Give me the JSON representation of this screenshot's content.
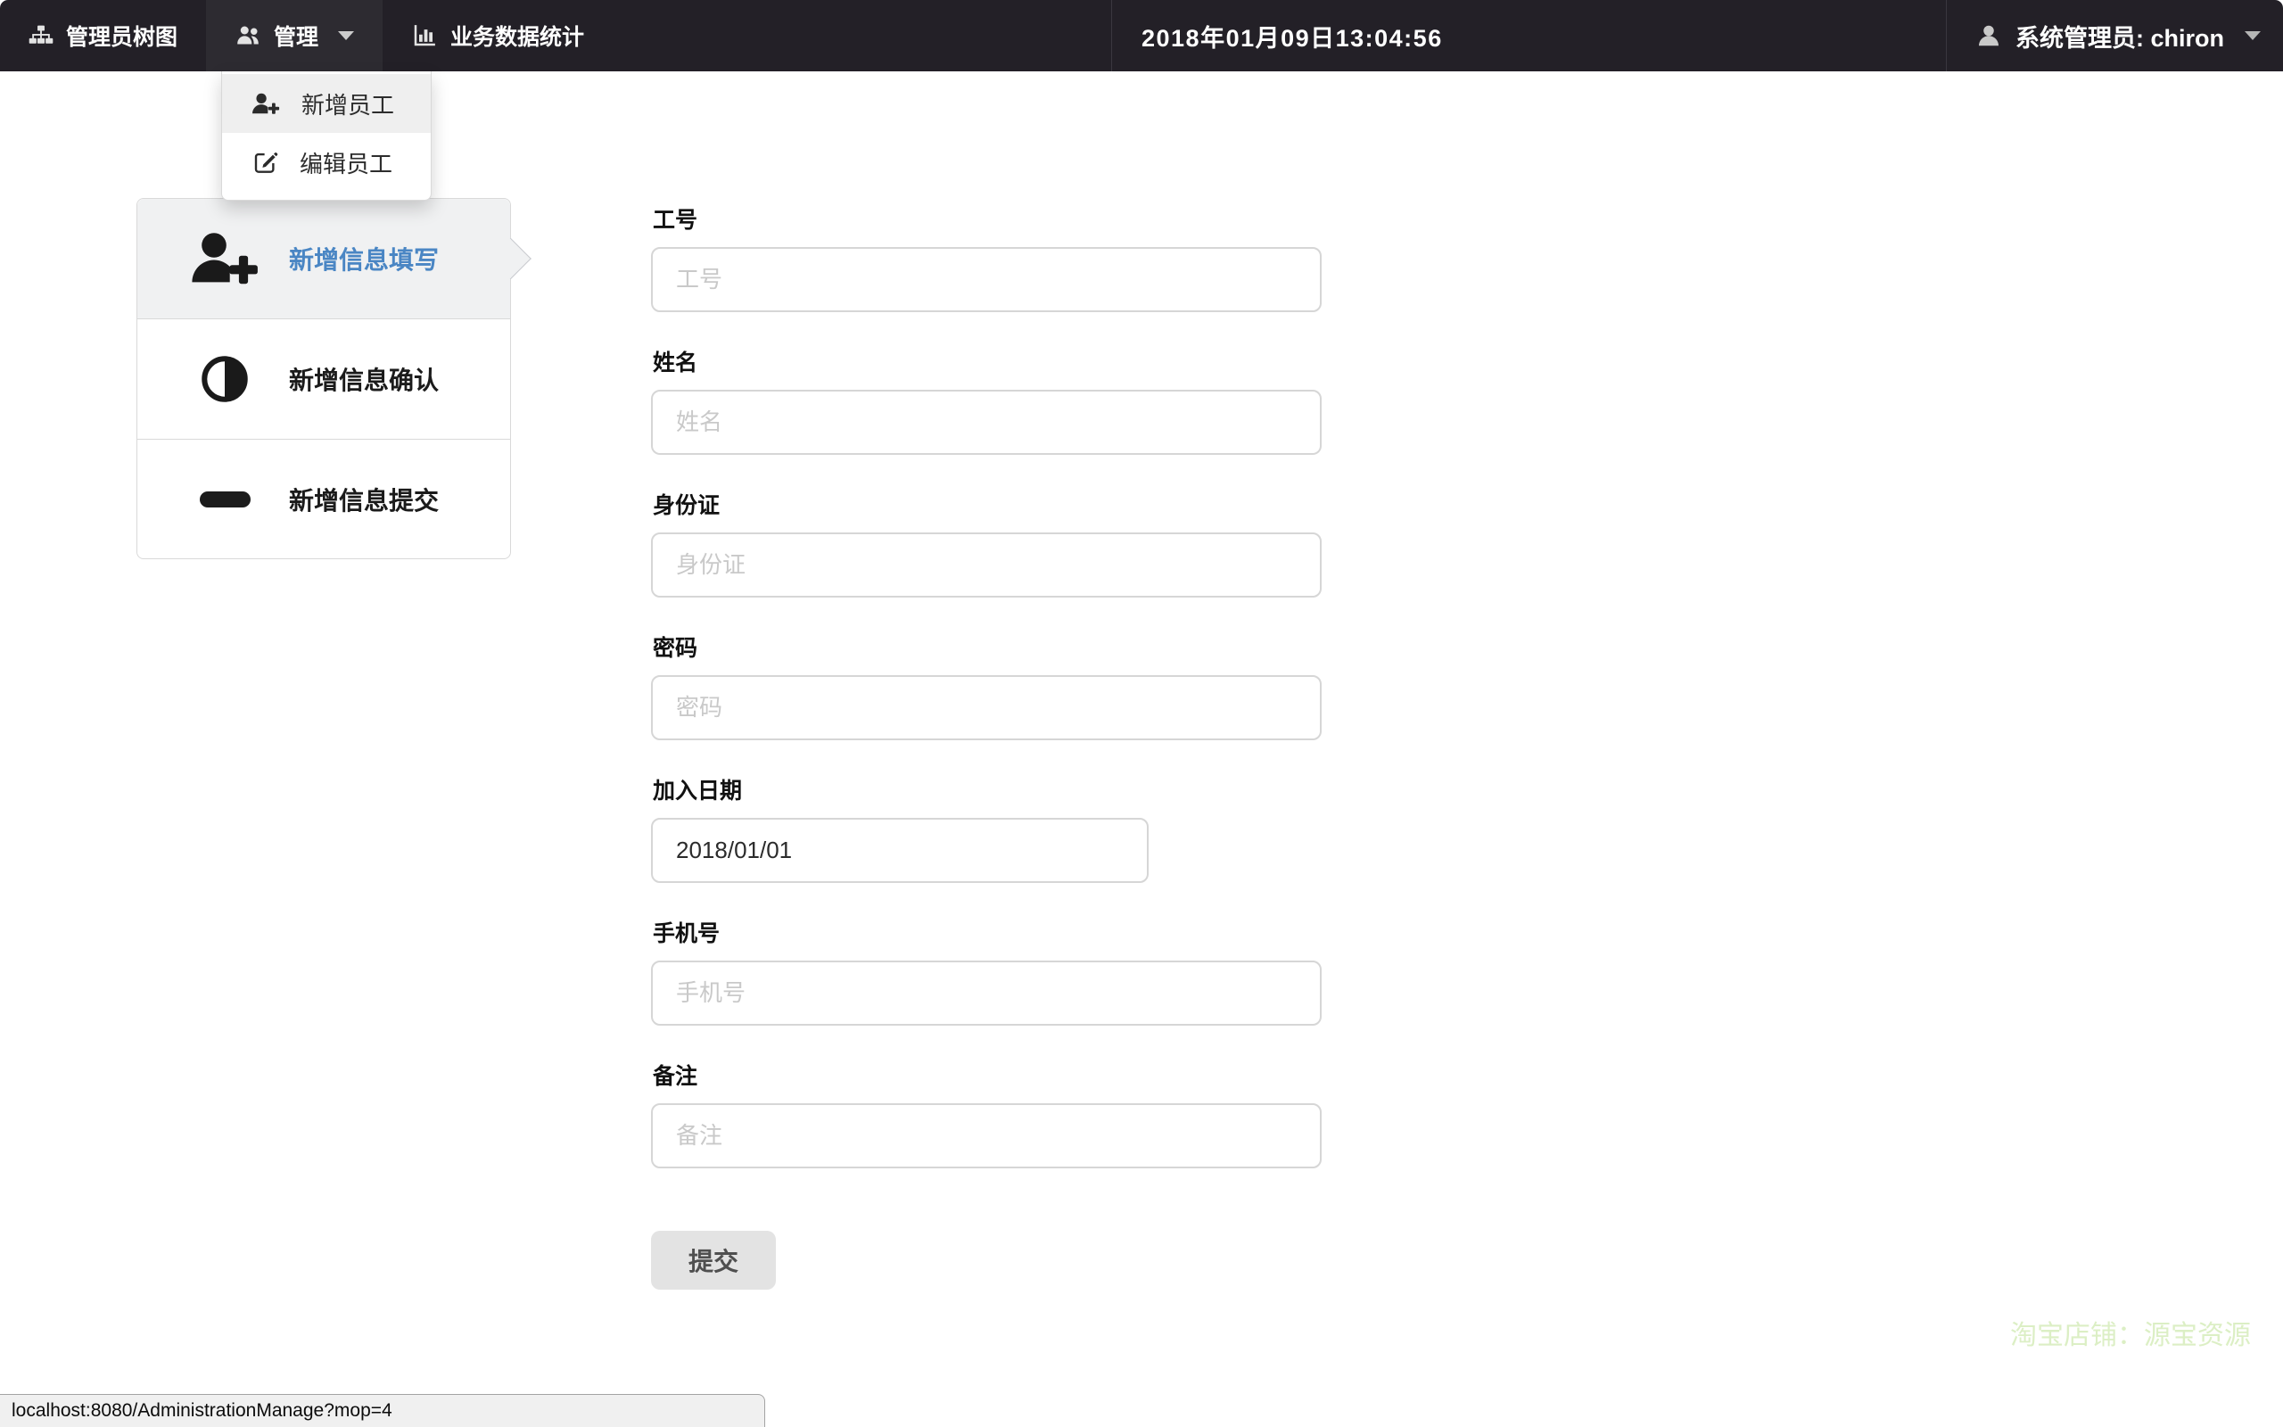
{
  "navbar": {
    "items": [
      {
        "label": "管理员树图",
        "icon": "sitemap-icon"
      },
      {
        "label": "管理",
        "icon": "users-icon",
        "open": true
      },
      {
        "label": "业务数据统计",
        "icon": "bar-chart-icon"
      }
    ],
    "datetime": "2018年01月09日13:04:56",
    "user": {
      "label": "系统管理员: chiron",
      "icon": "user-icon"
    }
  },
  "dropdown": {
    "items": [
      {
        "label": "新增员工",
        "icon": "user-plus-icon",
        "active": true
      },
      {
        "label": "编辑员工",
        "icon": "pencil-square-icon",
        "active": false
      }
    ]
  },
  "steps": [
    {
      "label": "新增信息填写",
      "icon": "user-plus-icon",
      "active": true
    },
    {
      "label": "新增信息确认",
      "icon": "adjust-icon",
      "active": false
    },
    {
      "label": "新增信息提交",
      "icon": "minus-icon",
      "active": false
    }
  ],
  "form": {
    "fields": [
      {
        "label": "工号",
        "placeholder": "工号"
      },
      {
        "label": "姓名",
        "placeholder": "姓名"
      },
      {
        "label": "身份证",
        "placeholder": "身份证"
      },
      {
        "label": "密码",
        "placeholder": "密码"
      },
      {
        "label": "加入日期",
        "value": "2018/01/01"
      },
      {
        "label": "手机号",
        "placeholder": "手机号"
      },
      {
        "label": "备注",
        "placeholder": "备注"
      }
    ],
    "submit_label": "提交"
  },
  "watermark": {
    "text": "淘宝店铺：源宝资源"
  },
  "statusbar": {
    "url": "localhost:8080/AdministrationManage?mop=4"
  },
  "colors": {
    "navbar_bg": "#232027",
    "accent_blue": "#4a86c4",
    "watermark_green": "#dcefc5",
    "active_row_bg": "#f0f1f2"
  }
}
